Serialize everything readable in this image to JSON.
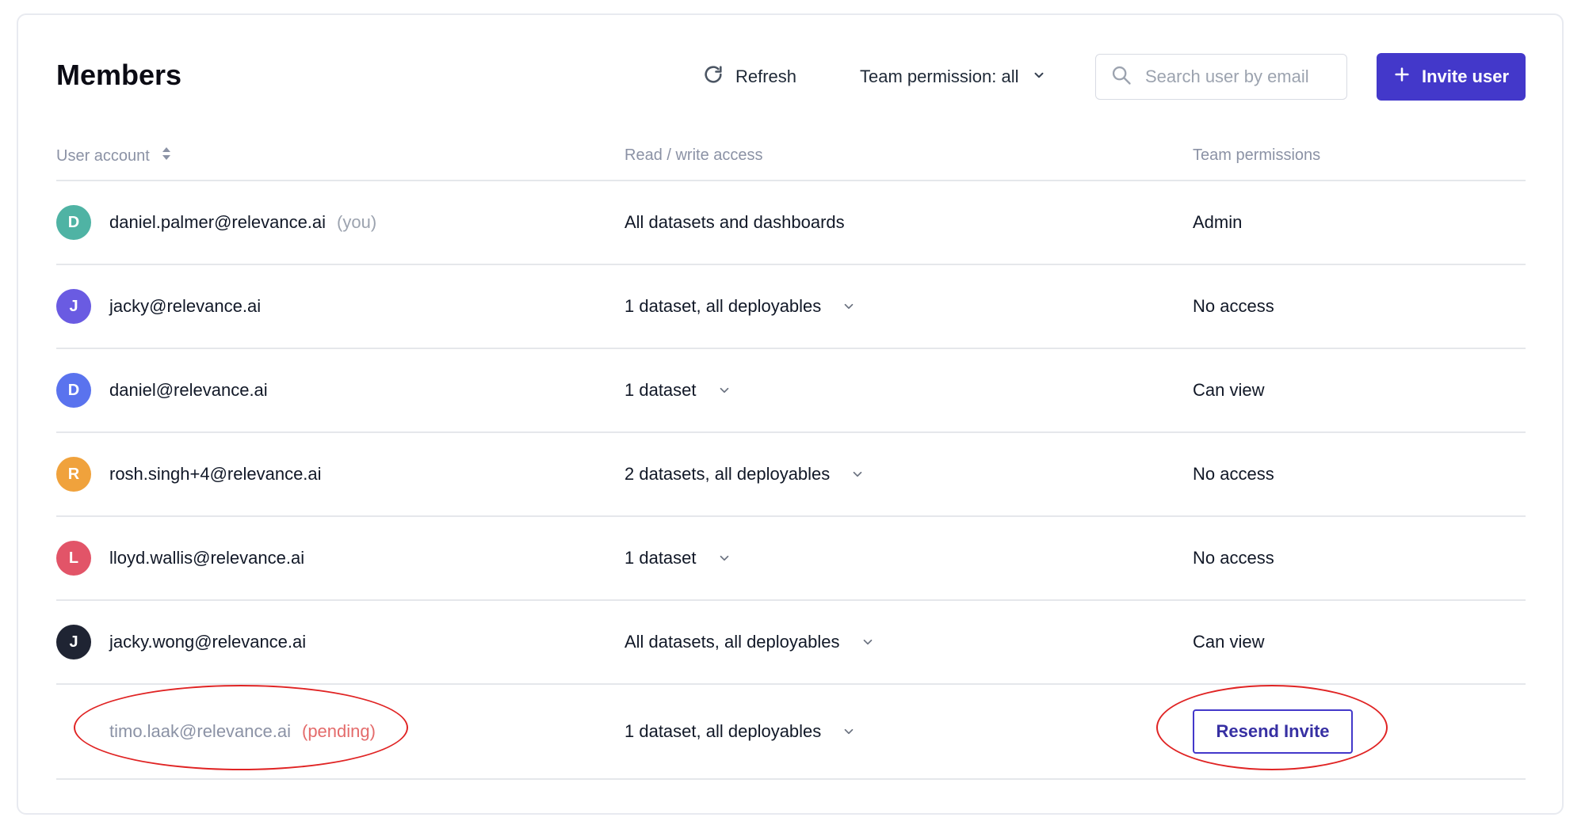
{
  "header": {
    "title": "Members",
    "refresh_label": "Refresh",
    "team_permission_filter": "Team permission: all",
    "search_placeholder": "Search user by email",
    "invite_label": "Invite user"
  },
  "columns": {
    "user_account": "User account",
    "read_write_access": "Read / write access",
    "team_permissions": "Team permissions"
  },
  "rows": [
    {
      "initial": "D",
      "avatar_color": "#4fb3a4",
      "email": "daniel.palmer@relevance.ai",
      "tag": "(you)",
      "access": "All datasets and dashboards",
      "permission": "Admin"
    },
    {
      "initial": "J",
      "avatar_color": "#6a5be2",
      "email": "jacky@relevance.ai",
      "access": "1 dataset, all deployables",
      "permission": "No access"
    },
    {
      "initial": "D",
      "avatar_color": "#5a73ee",
      "email": "daniel@relevance.ai",
      "access": "1 dataset",
      "permission": "Can view"
    },
    {
      "initial": "R",
      "avatar_color": "#f0a23c",
      "email": "rosh.singh+4@relevance.ai",
      "access": "2 datasets, all deployables",
      "permission": "No access"
    },
    {
      "initial": "L",
      "avatar_color": "#e25468",
      "email": "lloyd.wallis@relevance.ai",
      "access": "1 dataset",
      "permission": "No access"
    },
    {
      "initial": "J",
      "avatar_color": "#1f2433",
      "email": "jacky.wong@relevance.ai",
      "access": "All datasets, all deployables",
      "permission": "Can view"
    }
  ],
  "pending_row": {
    "email": "timo.laak@relevance.ai",
    "tag": "(pending)",
    "access": "1 dataset, all deployables",
    "action_label": "Resend Invite"
  },
  "colors": {
    "primary": "#4338ca",
    "pending_tag": "#e46b6b",
    "annotation": "#e02424"
  }
}
